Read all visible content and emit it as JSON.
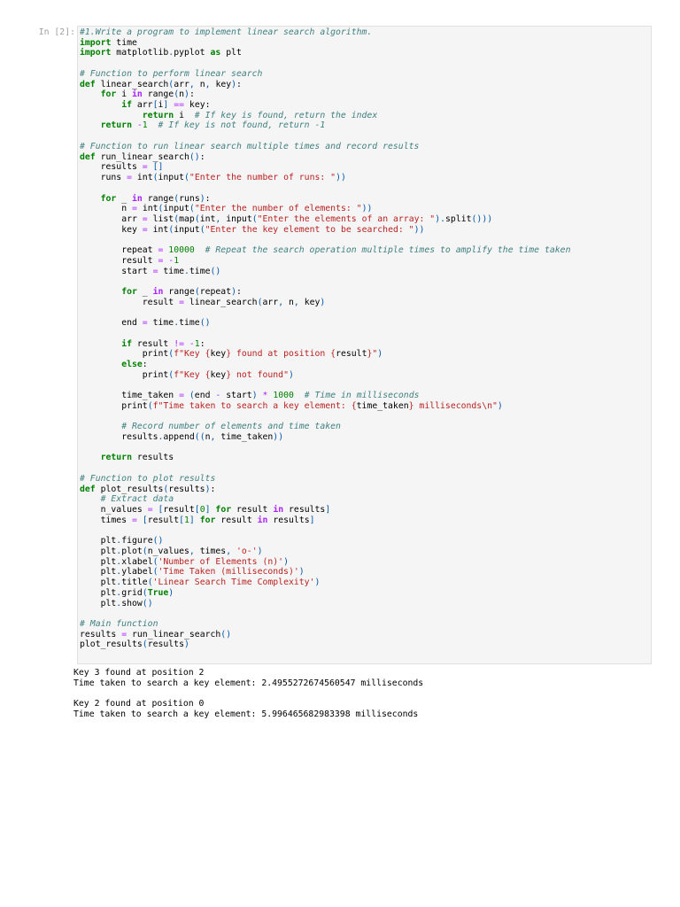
{
  "cell": {
    "prompt": "In [2]:",
    "code_lines": [
      "#1.Write a program to implement linear search algorithm.",
      "import time",
      "import matplotlib.pyplot as plt",
      "",
      "# Function to perform linear search",
      "def linear_search(arr, n, key):",
      "    for i in range(n):",
      "        if arr[i] == key:",
      "            return i  # If key is found, return the index",
      "    return -1  # If key is not found, return -1",
      "",
      "# Function to run linear search multiple times and record results",
      "def run_linear_search():",
      "    results = []",
      "    runs = int(input(\"Enter the number of runs: \"))",
      "",
      "    for _ in range(runs):",
      "        n = int(input(\"Enter the number of elements: \"))",
      "        arr = list(map(int, input(\"Enter the elements of an array: \").split()))",
      "        key = int(input(\"Enter the key element to be searched: \"))",
      "",
      "        repeat = 10000  # Repeat the search operation multiple times to amplify the time taken",
      "        result = -1",
      "        start = time.time()",
      "",
      "        for _ in range(repeat):",
      "            result = linear_search(arr, n, key)",
      "",
      "        end = time.time()",
      "",
      "        if result != -1:",
      "            print(f\"Key {key} found at position {result}\")",
      "        else:",
      "            print(f\"Key {key} not found\")",
      "",
      "        time_taken = (end - start) * 1000  # Time in milliseconds",
      "        print(f\"Time taken to search a key element: {time_taken} milliseconds\\n\")",
      "",
      "        # Record number of elements and time taken",
      "        results.append((n, time_taken))",
      "",
      "    return results",
      "",
      "# Function to plot results",
      "def plot_results(results):",
      "    # Extract data",
      "    n_values = [result[0] for result in results]",
      "    times = [result[1] for result in results]",
      "",
      "    plt.figure()",
      "    plt.plot(n_values, times, 'o-')",
      "    plt.xlabel('Number of Elements (n)')",
      "    plt.ylabel('Time Taken (milliseconds)')",
      "    plt.title('Linear Search Time Complexity')",
      "    plt.grid(True)",
      "    plt.show()",
      "",
      "# Main function",
      "results = run_linear_search()",
      "plot_results(results)"
    ]
  },
  "output": {
    "lines": [
      "Key 3 found at position 2",
      "Time taken to search a key element: 2.4955272674560547 milliseconds",
      "",
      "Key 2 found at position 0",
      "Time taken to search a key element: 5.996465682983398 milliseconds"
    ]
  }
}
